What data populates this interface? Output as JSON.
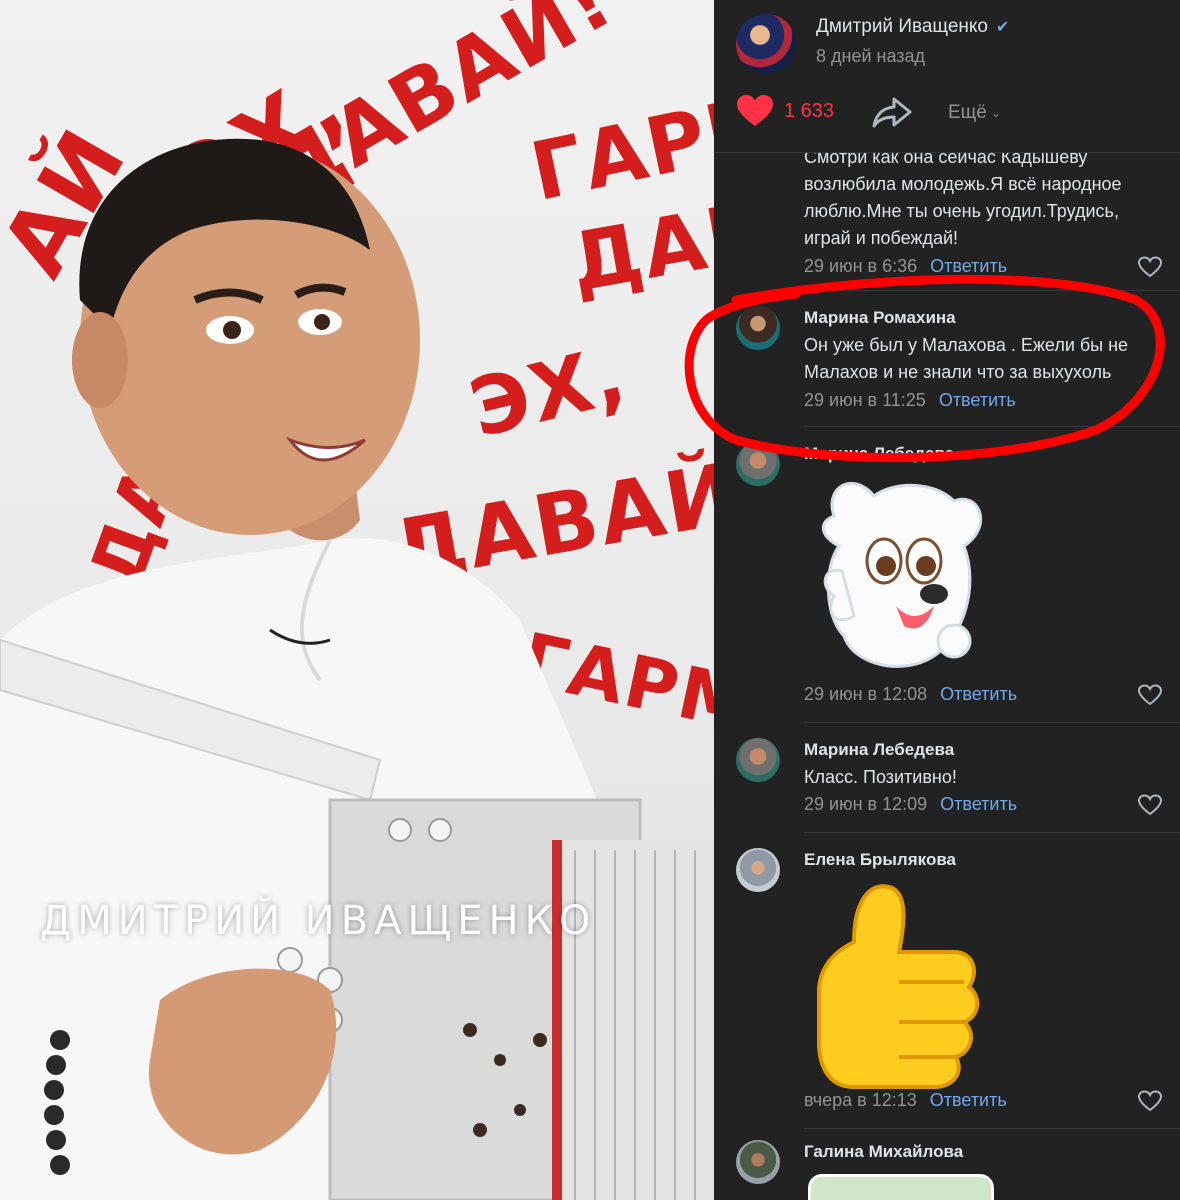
{
  "photo": {
    "caption": "ДМИТРИЙ ИВАЩЕНКО",
    "wall_text": [
      "ЭХ,",
      "ДАВАЙ!",
      "ГАРМ",
      "ДАВ",
      "ЭХ,",
      "ДАВАЙ!",
      "ГАРМ",
      "ДАВАЙ!",
      "АЙ"
    ]
  },
  "post": {
    "author": "Дмитрий Иващенко",
    "verified_mark": "✔",
    "date": "8 дней назад",
    "likes": "1 633",
    "more_label": "Ещё",
    "more_chevron": "⌄"
  },
  "comments": [
    {
      "name": "",
      "text": "Смотри как она сейчас Кадышеву возлюбила молодежь.Я всё народное люблю.Мне ты очень угодил.Трудись, играй и побеждай!",
      "date": "29 июн в 6:36",
      "reply": "Ответить"
    },
    {
      "name": "Марина Ромахина",
      "text": "Он уже был у Малахова . Ежели бы не Малахов и не знали что за выхухоль",
      "date": "29 июн в 11:25",
      "reply": "Ответить"
    },
    {
      "name": "Марина Лебедева",
      "text": "",
      "date": "29 июн в 12:08",
      "reply": "Ответить"
    },
    {
      "name": "Марина Лебедева",
      "text": "Класс. Позитивно!",
      "date": "29 июн в 12:09",
      "reply": "Ответить"
    },
    {
      "name": "Елена Брылякова",
      "text": "",
      "date": "вчера в 12:13",
      "reply": "Ответить"
    },
    {
      "name": "Галина Михайлова",
      "text": "",
      "date": "",
      "reply": ""
    }
  ],
  "colors": {
    "panel_bg": "#222222",
    "text": "#e1e3e6",
    "muted": "#939393",
    "link": "#71aaeb",
    "like": "#ff3347",
    "highlight_ring": "#ff0000"
  },
  "icons": [
    "heart-icon",
    "share-icon",
    "chevron-down-icon",
    "heart-outline-icon",
    "verified-icon"
  ]
}
